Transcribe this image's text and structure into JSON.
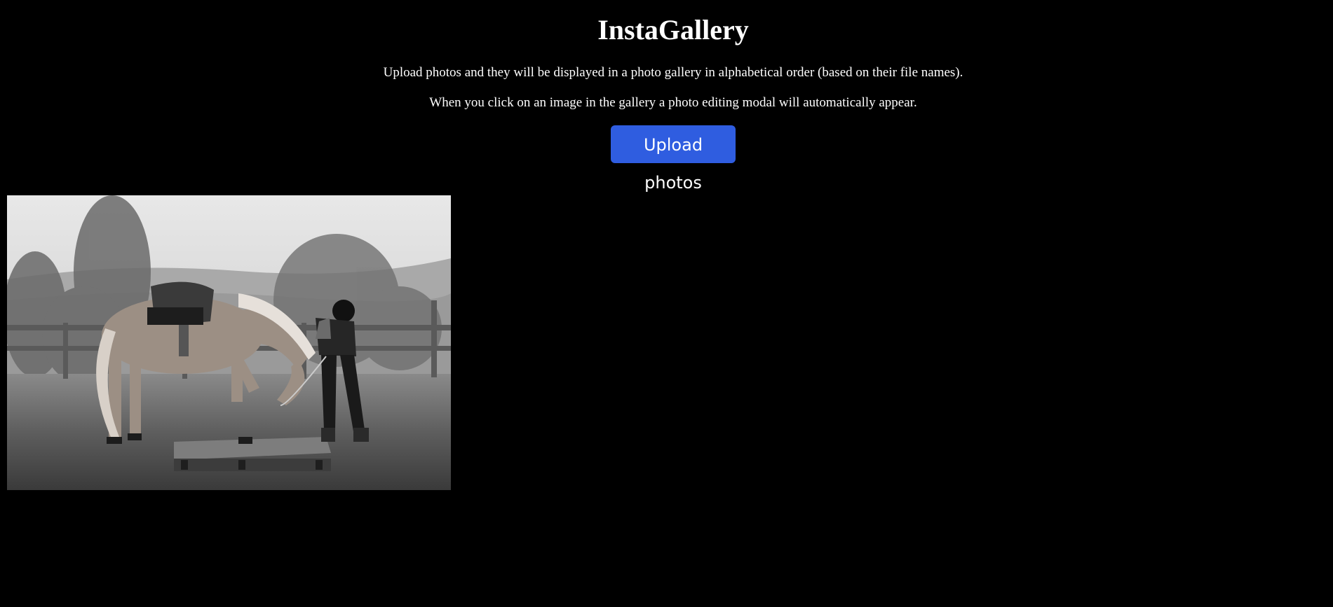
{
  "app": {
    "title": "InstaGallery",
    "description_line1": "Upload photos and they will be displayed in a photo gallery in alphabetical order (based on their file names).",
    "description_line2": "When you click on an image in the gallery a photo editing modal will automatically appear."
  },
  "toolbar": {
    "upload_label": "Upload photos"
  },
  "colors": {
    "background": "#000000",
    "text": "#ffffff",
    "accent": "#2f5de0"
  },
  "gallery": {
    "images": [
      {
        "description": "black-and-white photo of a horse stepping onto a wooden pallet with a rider beside it"
      }
    ]
  }
}
